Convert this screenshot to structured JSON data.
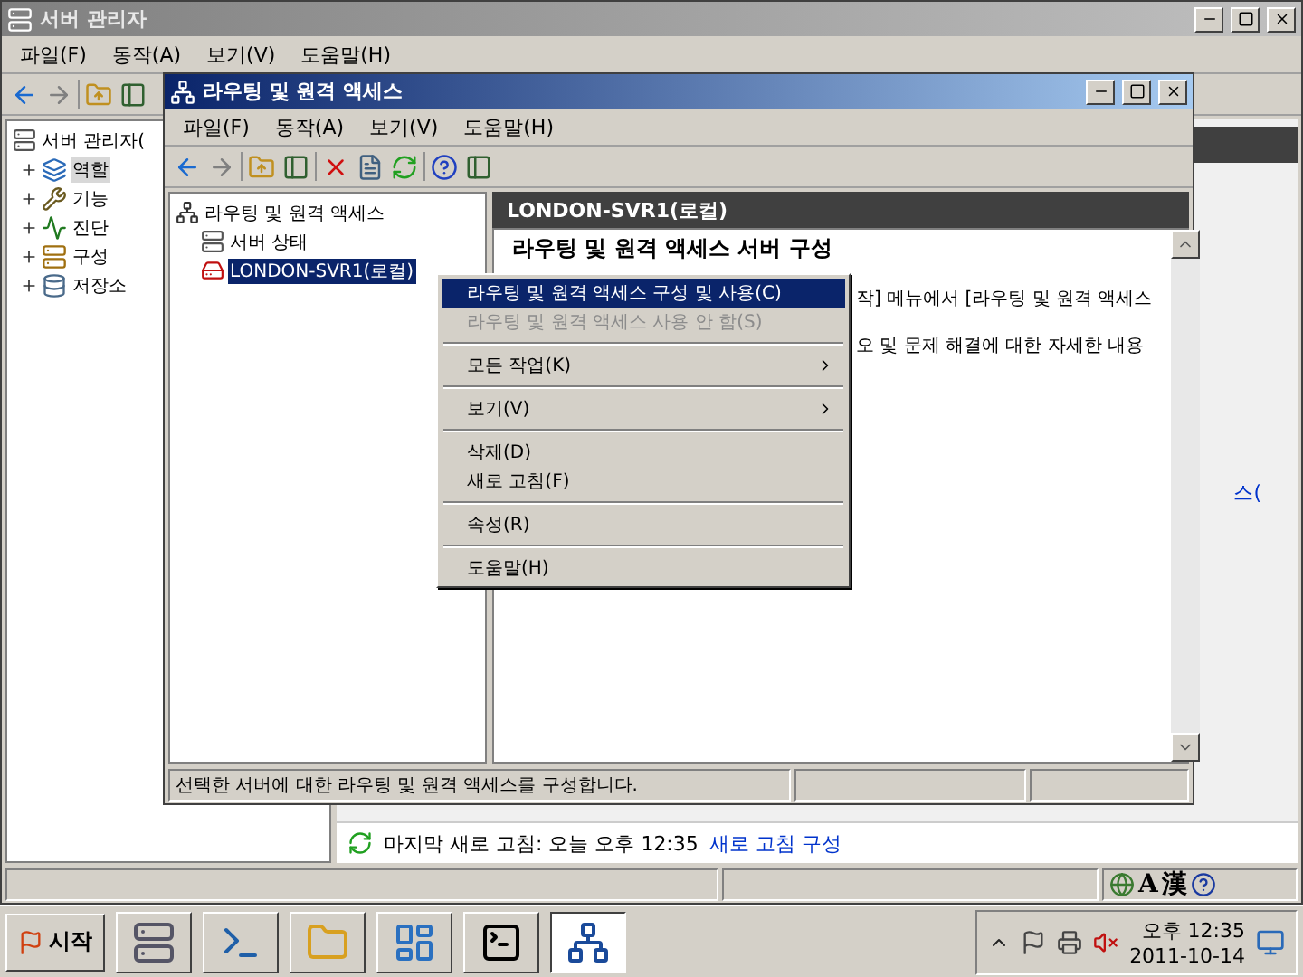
{
  "server_manager": {
    "title": "서버 관리자",
    "menu": [
      "파일(F)",
      "동작(A)",
      "보기(V)",
      "도움말(H)"
    ],
    "tree": {
      "label": "서버 관리자(",
      "children": [
        {
          "label": "역할",
          "selected": true
        },
        {
          "label": "기능",
          "selected": false
        },
        {
          "label": "진단",
          "selected": false
        },
        {
          "label": "구성",
          "selected": false
        },
        {
          "label": "저장소",
          "selected": false
        }
      ]
    },
    "partial_text": "스(",
    "refresh_text": "마지막 새로 고침: 오늘 오후 12:35",
    "refresh_link": "새로 고침 구성",
    "status_icons": [
      "A",
      "漢"
    ]
  },
  "rras": {
    "title": "라우팅 및 원격 액세스",
    "menu": [
      "파일(F)",
      "동작(A)",
      "보기(V)",
      "도움말(H)"
    ],
    "tree": {
      "label": "라우팅 및 원격 액세스",
      "children": [
        {
          "label": "서버 상태",
          "selected": false
        },
        {
          "label": "LONDON-SVR1(로컬)",
          "selected": true
        }
      ]
    },
    "pane_header": "LONDON-SVR1(로컬)",
    "pane_heading": "라우팅 및 원격 액세스 서버 구성",
    "pane_lines": [
      "작] 메뉴에서 [라우팅 및 원격 액세스",
      "오 및 문제 해결에 대한 자세한 내용"
    ],
    "status": "선택한 서버에 대한 라우팅 및 원격 액세스를 구성합니다."
  },
  "context_menu": [
    [
      {
        "label": "라우팅 및 원격 액세스 구성 및 사용(C)",
        "selected": true,
        "disabled": false,
        "submenu": false
      },
      {
        "label": "라우팅 및 원격 액세스 사용 안 함(S)",
        "selected": false,
        "disabled": true,
        "submenu": false
      }
    ],
    [
      {
        "label": "모든 작업(K)",
        "selected": false,
        "disabled": false,
        "submenu": true
      }
    ],
    [
      {
        "label": "보기(V)",
        "selected": false,
        "disabled": false,
        "submenu": true
      }
    ],
    [
      {
        "label": "삭제(D)",
        "selected": false,
        "disabled": false,
        "submenu": false
      },
      {
        "label": "새로 고침(F)",
        "selected": false,
        "disabled": false,
        "submenu": false
      }
    ],
    [
      {
        "label": "속성(R)",
        "selected": false,
        "disabled": false,
        "submenu": false
      }
    ],
    [
      {
        "label": "도움말(H)",
        "selected": false,
        "disabled": false,
        "submenu": false
      }
    ]
  ],
  "taskbar": {
    "start": "시작",
    "apps": [
      {
        "kind": "server",
        "selected": false
      },
      {
        "kind": "powershell",
        "selected": false
      },
      {
        "kind": "explorer",
        "selected": false
      },
      {
        "kind": "control",
        "selected": false
      },
      {
        "kind": "cmd",
        "selected": false
      },
      {
        "kind": "network",
        "selected": true
      }
    ],
    "time": "오후 12:35",
    "date": "2011-10-14"
  }
}
